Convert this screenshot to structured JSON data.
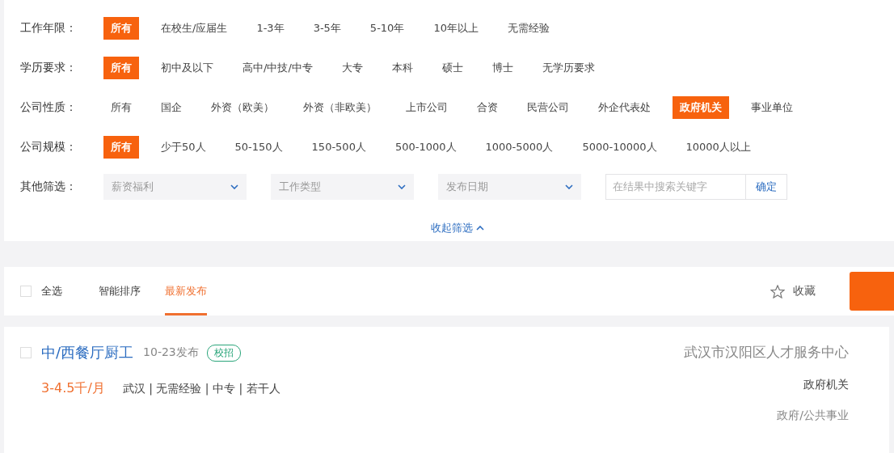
{
  "filters": [
    {
      "label": "工作年限：",
      "options": [
        {
          "text": "所有",
          "selected": true
        },
        {
          "text": "在校生/应届生",
          "selected": false
        },
        {
          "text": "1-3年",
          "selected": false
        },
        {
          "text": "3-5年",
          "selected": false
        },
        {
          "text": "5-10年",
          "selected": false
        },
        {
          "text": "10年以上",
          "selected": false
        },
        {
          "text": "无需经验",
          "selected": false
        }
      ]
    },
    {
      "label": "学历要求：",
      "options": [
        {
          "text": "所有",
          "selected": true
        },
        {
          "text": "初中及以下",
          "selected": false
        },
        {
          "text": "高中/中技/中专",
          "selected": false
        },
        {
          "text": "大专",
          "selected": false
        },
        {
          "text": "本科",
          "selected": false
        },
        {
          "text": "硕士",
          "selected": false
        },
        {
          "text": "博士",
          "selected": false
        },
        {
          "text": "无学历要求",
          "selected": false
        }
      ]
    },
    {
      "label": "公司性质：",
      "options": [
        {
          "text": "所有",
          "selected": false
        },
        {
          "text": "国企",
          "selected": false
        },
        {
          "text": "外资（欧美）",
          "selected": false
        },
        {
          "text": "外资（非欧美）",
          "selected": false
        },
        {
          "text": "上市公司",
          "selected": false
        },
        {
          "text": "合资",
          "selected": false
        },
        {
          "text": "民营公司",
          "selected": false
        },
        {
          "text": "外企代表处",
          "selected": false
        },
        {
          "text": "政府机关",
          "selected": true
        },
        {
          "text": "事业单位",
          "selected": false
        }
      ]
    },
    {
      "label": "公司规模：",
      "options": [
        {
          "text": "所有",
          "selected": true
        },
        {
          "text": "少于50人",
          "selected": false
        },
        {
          "text": "50-150人",
          "selected": false
        },
        {
          "text": "150-500人",
          "selected": false
        },
        {
          "text": "500-1000人",
          "selected": false
        },
        {
          "text": "1000-5000人",
          "selected": false
        },
        {
          "text": "5000-10000人",
          "selected": false
        },
        {
          "text": "10000人以上",
          "selected": false
        }
      ]
    }
  ],
  "other_filters": {
    "label": "其他筛选：",
    "dropdowns": [
      "薪资福利",
      "工作类型",
      "发布日期"
    ],
    "search": {
      "placeholder": "在结果中搜索关键字",
      "button": "确定"
    }
  },
  "collapse": "收起筛选",
  "sort_bar": {
    "select_all": {
      "label": "全选",
      "checked": false
    },
    "tabs": [
      {
        "label": "智能排序",
        "selected": false
      },
      {
        "label": "最新发布",
        "selected": true
      }
    ],
    "favorite": "收藏"
  },
  "jobs": [
    {
      "checked": false,
      "title": "中/西餐厅厨工",
      "date": "10-23发布",
      "tag": "校招",
      "salary": "3-4.5千/月",
      "details": "武汉 | 无需经验 | 中专 | 若干人",
      "company": "武汉市汉阳区人才服务中心",
      "company_type": "政府机关",
      "industry": "政府/公共事业"
    }
  ]
}
